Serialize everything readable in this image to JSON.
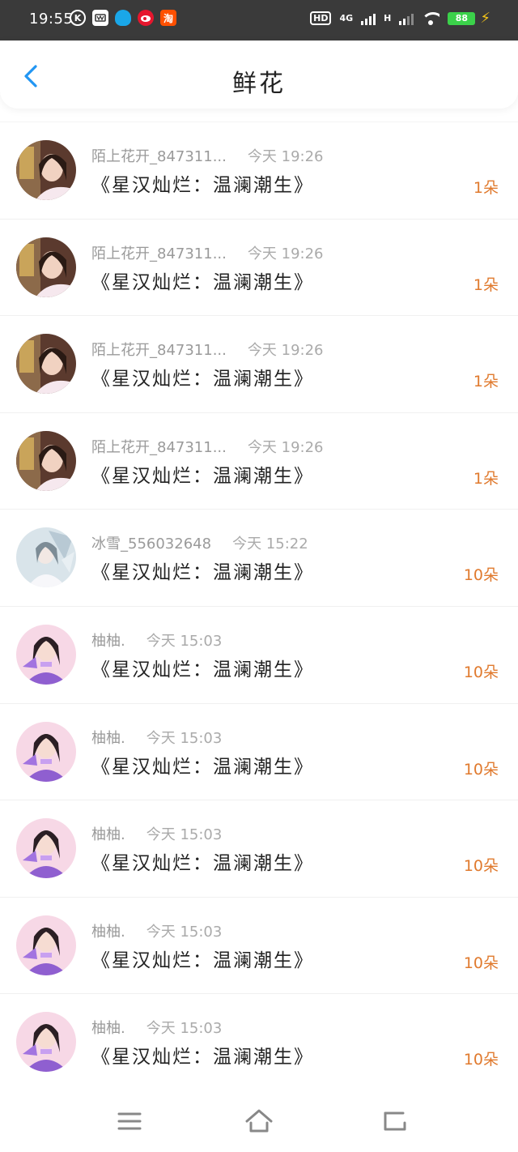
{
  "status_bar": {
    "time": "19:55",
    "app_icons": [
      {
        "name": "k-app-icon",
        "glyph": "K"
      },
      {
        "name": "wechat-icon",
        "glyph": "W"
      },
      {
        "name": "qq-icon",
        "glyph": ""
      },
      {
        "name": "weibo-icon",
        "glyph": ""
      },
      {
        "name": "taobao-icon",
        "glyph": "淘"
      }
    ],
    "hd": "HD",
    "net1": "4G",
    "net2": "H",
    "battery": "88"
  },
  "header": {
    "title": "鲜花",
    "back_icon": "chevron-left-icon",
    "accent": "#2196f3"
  },
  "colors": {
    "count_color": "#e07a2e",
    "status_bar_bg": "#3a3a3a"
  },
  "records": [
    {
      "user": "陌上花开_847311...",
      "time": "今天 19:26",
      "book": "《星汉灿烂：温澜潮生》",
      "count": "1朵",
      "avatar": "girl-photo-avatar"
    },
    {
      "user": "陌上花开_847311...",
      "time": "今天 19:26",
      "book": "《星汉灿烂：温澜潮生》",
      "count": "1朵",
      "avatar": "girl-photo-avatar"
    },
    {
      "user": "陌上花开_847311...",
      "time": "今天 19:26",
      "book": "《星汉灿烂：温澜潮生》",
      "count": "1朵",
      "avatar": "girl-photo-avatar"
    },
    {
      "user": "陌上花开_847311...",
      "time": "今天 19:26",
      "book": "《星汉灿烂：温澜潮生》",
      "count": "1朵",
      "avatar": "girl-photo-avatar"
    },
    {
      "user": "冰雪_556032648",
      "time": "今天 15:22",
      "book": "《星汉灿烂：温澜潮生》",
      "count": "10朵",
      "avatar": "white-costume-avatar"
    },
    {
      "user": "柚柚.",
      "time": "今天 15:03",
      "book": "《星汉灿烂：温澜潮生》",
      "count": "10朵",
      "avatar": "purple-girl-avatar"
    },
    {
      "user": "柚柚.",
      "time": "今天 15:03",
      "book": "《星汉灿烂：温澜潮生》",
      "count": "10朵",
      "avatar": "purple-girl-avatar"
    },
    {
      "user": "柚柚.",
      "time": "今天 15:03",
      "book": "《星汉灿烂：温澜潮生》",
      "count": "10朵",
      "avatar": "purple-girl-avatar"
    },
    {
      "user": "柚柚.",
      "time": "今天 15:03",
      "book": "《星汉灿烂：温澜潮生》",
      "count": "10朵",
      "avatar": "purple-girl-avatar"
    },
    {
      "user": "柚柚.",
      "time": "今天 15:03",
      "book": "《星汉灿烂：温澜潮生》",
      "count": "10朵",
      "avatar": "purple-girl-avatar"
    }
  ],
  "nav_bar": {
    "menu_icon": "menu-icon",
    "home_icon": "home-icon",
    "back_icon": "back-icon"
  }
}
